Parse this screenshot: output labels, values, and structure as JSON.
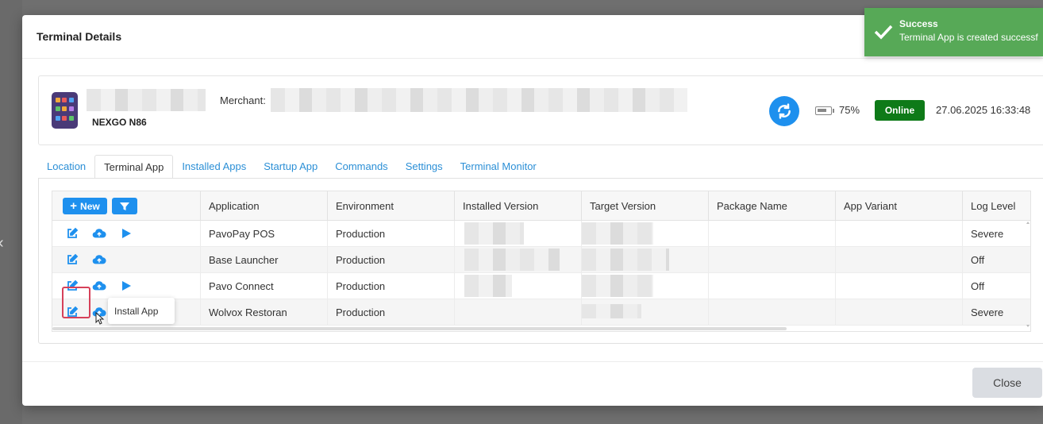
{
  "modal": {
    "title": "Terminal Details",
    "close_label": "Close"
  },
  "device": {
    "model": "NEXGO N86",
    "merchant_label": "Merchant:",
    "battery": "75%",
    "battery_level": 0.75,
    "status": "Online",
    "timestamp": "27.06.2025 16:33:48"
  },
  "tabs": [
    {
      "label": "Location",
      "active": false
    },
    {
      "label": "Terminal App",
      "active": true
    },
    {
      "label": "Installed Apps",
      "active": false
    },
    {
      "label": "Startup App",
      "active": false
    },
    {
      "label": "Commands",
      "active": false
    },
    {
      "label": "Settings",
      "active": false
    },
    {
      "label": "Terminal Monitor",
      "active": false
    }
  ],
  "grid": {
    "new_label": "New",
    "columns": [
      "Application",
      "Environment",
      "Installed Version",
      "Target Version",
      "Package Name",
      "App Variant",
      "Log Level"
    ],
    "rows": [
      {
        "application": "PavoPay POS",
        "environment": "Production",
        "log_level": "Severe",
        "has_play": true
      },
      {
        "application": "Base Launcher",
        "environment": "Production",
        "log_level": "Off",
        "has_play": false
      },
      {
        "application": "Pavo Connect",
        "environment": "Production",
        "log_level": "Off",
        "has_play": true
      },
      {
        "application": "Wolvox Restoran",
        "environment": "Production",
        "log_level": "Severe",
        "has_play": false
      }
    ]
  },
  "tooltip": {
    "text": "Install App"
  },
  "toast": {
    "title": "Success",
    "message": "Terminal App is created successf"
  },
  "colors": {
    "primary": "#1e90ee",
    "online": "#0e7a18",
    "toast": "#57a957",
    "highlight": "#d6415a"
  }
}
